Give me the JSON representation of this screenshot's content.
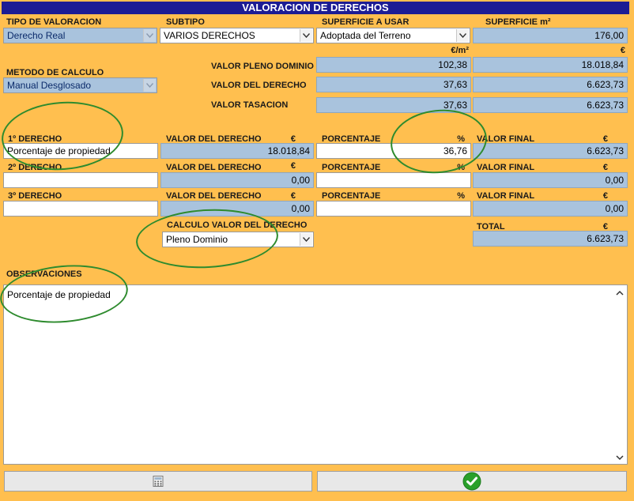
{
  "title": "VALORACION DE DERECHOS",
  "labels": {
    "tipo_valoracion": "TIPO DE VALORACION",
    "subtipo": "SUBTIPO",
    "superficie_usar": "SUPERFICIE A USAR",
    "superficie_m2": "SUPERFICIE  m²",
    "metodo_calculo": "METODO DE CALCULO",
    "valor_pleno_dominio": "VALOR PLENO DOMINIO",
    "valor_del_derecho": "VALOR DEL DERECHO",
    "valor_tasacion": "VALOR TASACION",
    "derecho1": "1º DERECHO",
    "derecho2": "2º DERECHO",
    "derecho3": "3º DERECHO",
    "valor_derecho_col": "VALOR DEL DERECHO",
    "porcentaje": "PORCENTAJE",
    "valor_final": "VALOR FINAL",
    "calculo_valor_derecho": "CALCULO VALOR DEL DERECHO",
    "total": "TOTAL",
    "observaciones": "OBSERVACIONES"
  },
  "units": {
    "eur_m2": "€/m²",
    "eur": "€",
    "pct": "%"
  },
  "fields": {
    "tipo_valoracion": "Derecho Real",
    "subtipo": "VARIOS DERECHOS",
    "superficie_usar": "Adoptada del Terreno",
    "superficie_m2": "176,00",
    "metodo_calculo": "Manual Desglosado",
    "pleno_dominio_unit": "102,38",
    "pleno_dominio_total": "18.018,84",
    "valor_derecho_unit": "37,63",
    "valor_derecho_total": "6.623,73",
    "tasacion_unit": "37,63",
    "tasacion_total": "6.623,73",
    "calculo_valor_derecho": "Pleno Dominio",
    "total": "6.623,73",
    "observaciones": "Porcentaje de propiedad"
  },
  "derechos": [
    {
      "nombre": "Porcentaje de propiedad",
      "valor": "18.018,84",
      "porcentaje": "36,76",
      "final": "6.623,73"
    },
    {
      "nombre": "",
      "valor": "0,00",
      "porcentaje": "",
      "final": "0,00"
    },
    {
      "nombre": "",
      "valor": "0,00",
      "porcentaje": "",
      "final": "0,00"
    }
  ],
  "icons": {
    "calculator": "calculator-icon",
    "confirm": "check-circle-icon"
  },
  "colors": {
    "background": "#ffbf4f",
    "title_bar": "#1c1c94",
    "readonly_field": "#a9c3dd",
    "confirm_green": "#2aa02a",
    "annotation": "#2e8b2e"
  }
}
